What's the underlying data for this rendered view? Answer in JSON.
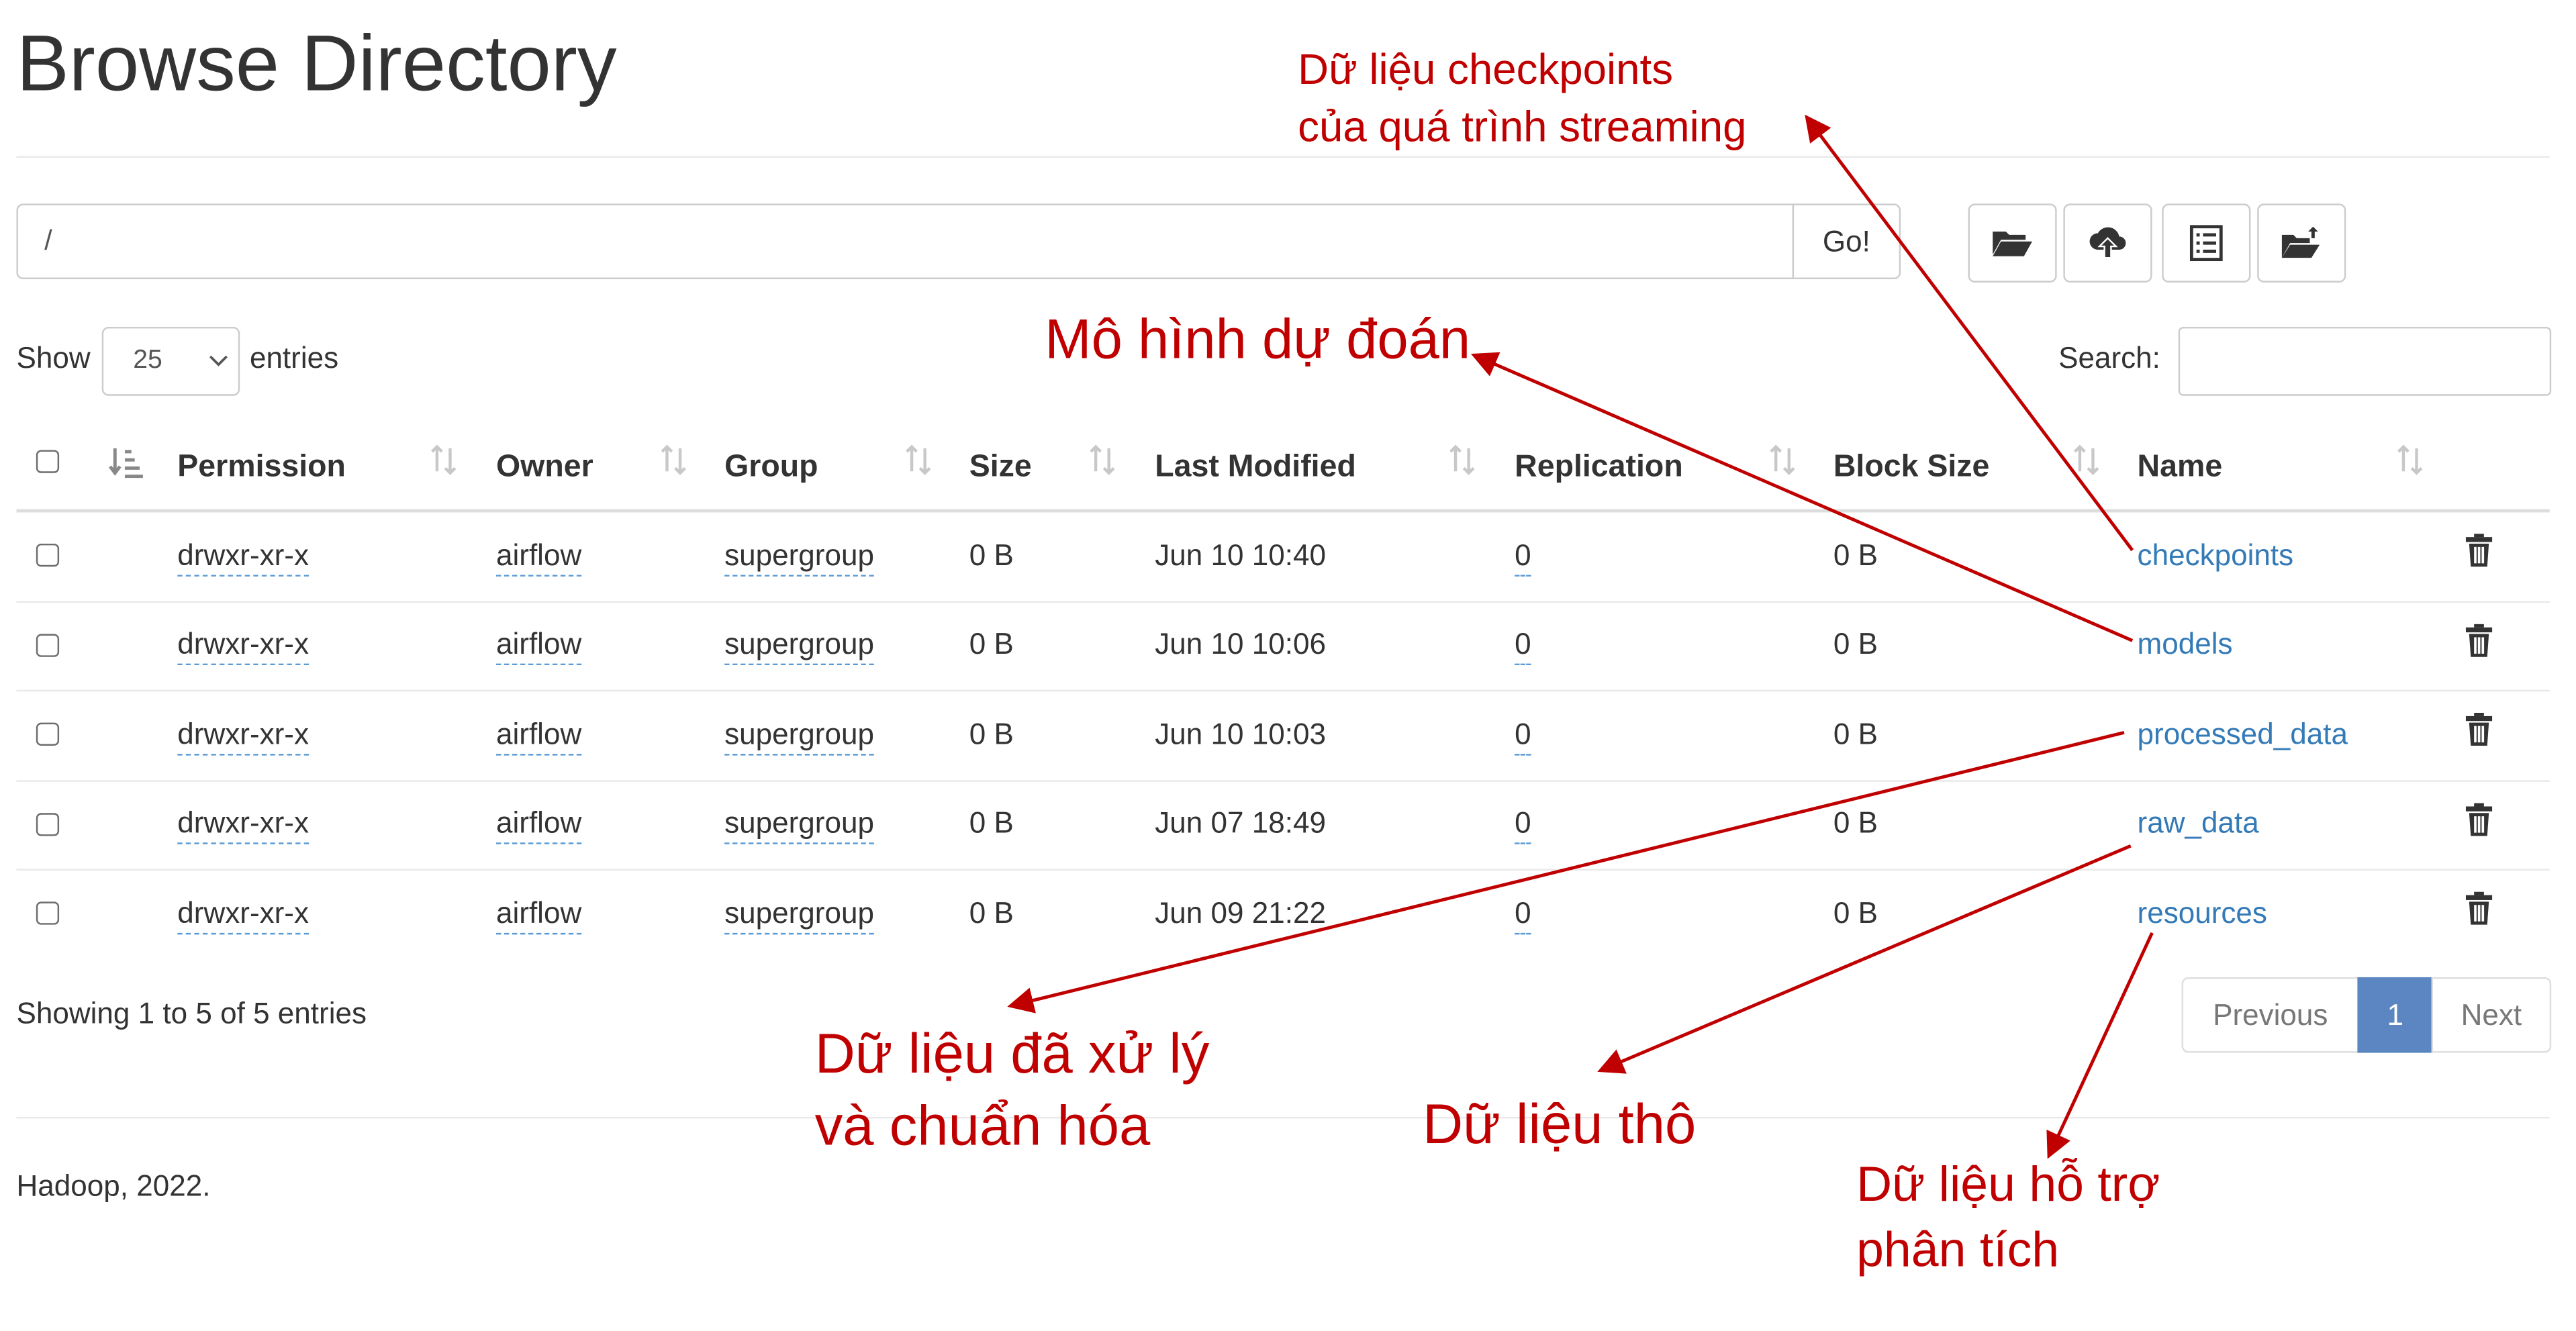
{
  "page": {
    "title": "Browse Directory",
    "path_value": "/",
    "go_label": "Go!"
  },
  "toolbar": {
    "icons": [
      "folder-open-icon",
      "cloud-upload-icon",
      "list-alt-icon",
      "folder-upload-icon"
    ]
  },
  "table_controls": {
    "show_label": "Show",
    "page_size": "25",
    "entries_label": "entries",
    "search_label": "Search:",
    "search_value": ""
  },
  "table": {
    "columns": [
      "Permission",
      "Owner",
      "Group",
      "Size",
      "Last Modified",
      "Replication",
      "Block Size",
      "Name"
    ],
    "rows": [
      {
        "permission": "drwxr-xr-x",
        "owner": "airflow",
        "group": "supergroup",
        "size": "0 B",
        "modified": "Jun 10 10:40",
        "replication": "0",
        "block_size": "0 B",
        "name": "checkpoints"
      },
      {
        "permission": "drwxr-xr-x",
        "owner": "airflow",
        "group": "supergroup",
        "size": "0 B",
        "modified": "Jun 10 10:06",
        "replication": "0",
        "block_size": "0 B",
        "name": "models"
      },
      {
        "permission": "drwxr-xr-x",
        "owner": "airflow",
        "group": "supergroup",
        "size": "0 B",
        "modified": "Jun 10 10:03",
        "replication": "0",
        "block_size": "0 B",
        "name": "processed_data"
      },
      {
        "permission": "drwxr-xr-x",
        "owner": "airflow",
        "group": "supergroup",
        "size": "0 B",
        "modified": "Jun 07 18:49",
        "replication": "0",
        "block_size": "0 B",
        "name": "raw_data"
      },
      {
        "permission": "drwxr-xr-x",
        "owner": "airflow",
        "group": "supergroup",
        "size": "0 B",
        "modified": "Jun 09 21:22",
        "replication": "0",
        "block_size": "0 B",
        "name": "resources"
      }
    ]
  },
  "footer_info": {
    "showing": "Showing 1 to 5 of 5 entries",
    "previous": "Previous",
    "current_page": "1",
    "next": "Next",
    "copyright": "Hadoop, 2022."
  },
  "colors": {
    "annotation": "#c00000",
    "link": "#337ab7",
    "active_page": "#5b86c1"
  },
  "annotations": {
    "checkpoints": [
      "Dữ liệu checkpoints",
      "của quá trình streaming"
    ],
    "models": "Mô hình dự đoán",
    "processed": [
      "Dữ liệu đã xử lý",
      "và chuẩn hóa"
    ],
    "raw": "Dữ liệu thô",
    "resources": [
      "Dữ liệu hỗ trợ",
      "phân tích"
    ]
  }
}
